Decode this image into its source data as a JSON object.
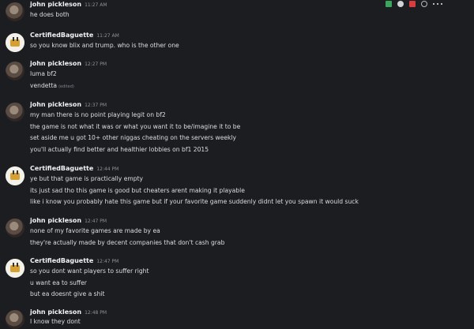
{
  "toolbar": {
    "icons": [
      "check-icon",
      "person-icon",
      "flag-icon",
      "circle-icon",
      "more-icon"
    ],
    "colors": {
      "check": "#3ba55d",
      "flag": "#d83c3e"
    }
  },
  "messages": [
    {
      "author": "john pickleson",
      "time": "11:27 AM",
      "avatar": "john",
      "lines": [
        "he does both"
      ]
    },
    {
      "author": "CertifiedBaguette",
      "time": "11:27 AM",
      "avatar": "baguette",
      "lines": [
        "so you know blix and trump. who is the other one"
      ]
    },
    {
      "author": "john pickleson",
      "time": "12:27 PM",
      "avatar": "john",
      "lines": [
        "luma bf2",
        "vendetta"
      ],
      "edited_label": "(edited)"
    },
    {
      "author": "john pickleson",
      "time": "12:37 PM",
      "avatar": "john",
      "lines": [
        "my man there is no point playing legit on bf2",
        "the game is not what it was or what you want it to be/imagine it to be",
        "set aside me u got 10+ other niggas cheating on the servers weekly",
        "you'll actually find better and healthier lobbies on bf1 2015"
      ]
    },
    {
      "author": "CertifiedBaguette",
      "time": "12:44 PM",
      "avatar": "baguette",
      "lines": [
        "ye but that game is practically empty",
        "its just sad tho this game is good but cheaters arent making it playable",
        "like i know you probably hate this game but if your favorite game suddenly didnt let you spawn it would suck"
      ]
    },
    {
      "author": "john pickleson",
      "time": "12:47 PM",
      "avatar": "john",
      "lines": [
        "none of my favorite games are made by ea",
        "they're actually made by decent companies that don't cash grab"
      ]
    },
    {
      "author": "CertifiedBaguette",
      "time": "12:47 PM",
      "avatar": "baguette",
      "lines": [
        "so you dont want players to suffer right",
        "u want ea to suffer",
        "but ea doesnt give a shit"
      ]
    },
    {
      "author": "john pickleson",
      "time": "12:48 PM",
      "avatar": "john",
      "lines": [
        "I know they dont"
      ]
    }
  ]
}
